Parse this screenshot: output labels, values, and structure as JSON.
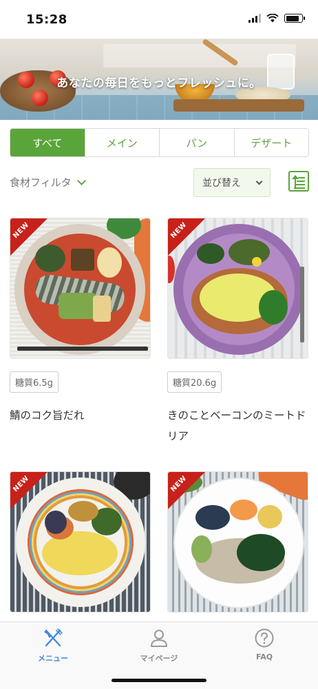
{
  "status_bar": {
    "time": "15:28",
    "battery_level": 0.85
  },
  "hero": {
    "tagline": "あなたの毎日をもっとフレッシュに。"
  },
  "tabs": [
    {
      "label": "すべて",
      "active": true
    },
    {
      "label": "メイン",
      "active": false
    },
    {
      "label": "パン",
      "active": false
    },
    {
      "label": "デザート",
      "active": false
    }
  ],
  "filter": {
    "ingredient_label": "食材フィルタ",
    "sort_label": "並び替え"
  },
  "menu_items": [
    {
      "badge": "NEW",
      "carbs": "糖質6.5g",
      "title": "鯖のコク旨だれ"
    },
    {
      "badge": "NEW",
      "carbs": "糖質20.6g",
      "title": "きのことベーコンのミートドリア"
    },
    {
      "badge": "NEW",
      "carbs": "",
      "title": ""
    },
    {
      "badge": "NEW",
      "carbs": "",
      "title": ""
    }
  ],
  "bottom_nav": [
    {
      "label": "メニュー",
      "icon": "fork-knife-icon",
      "active": true
    },
    {
      "label": "マイページ",
      "icon": "person-icon",
      "active": false
    },
    {
      "label": "FAQ",
      "icon": "question-icon",
      "active": false
    }
  ],
  "colors": {
    "accent_green": "#5aa53a",
    "active_nav_blue": "#3d8be0",
    "new_ribbon_red": "#c8211a"
  }
}
